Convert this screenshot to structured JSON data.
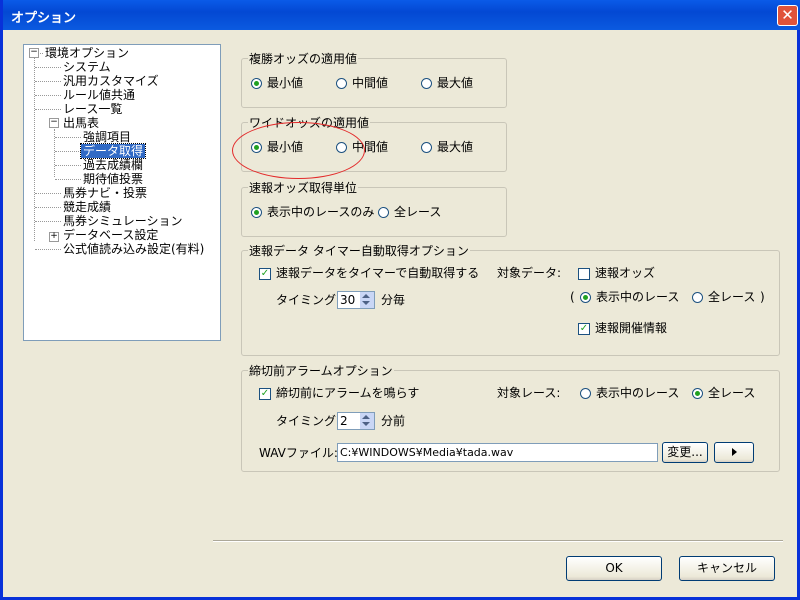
{
  "window": {
    "title": "オプション"
  },
  "tree": {
    "items": [
      {
        "label": "環境オプション",
        "expander": "−"
      },
      {
        "label": "システム"
      },
      {
        "label": "汎用カスタマイズ"
      },
      {
        "label": "ルール値共通"
      },
      {
        "label": "レース一覧"
      },
      {
        "label": "出馬表",
        "expander": "−"
      },
      {
        "label": "強調項目"
      },
      {
        "label": "データ取得",
        "selected": true
      },
      {
        "label": "過去成績欄"
      },
      {
        "label": "期待値投票"
      },
      {
        "label": "馬券ナビ・投票"
      },
      {
        "label": "競走成績"
      },
      {
        "label": "馬券シミュレーション"
      },
      {
        "label": "データベース設定",
        "expander": "+"
      },
      {
        "label": "公式値読み込み設定(有料)"
      }
    ]
  },
  "fukusho": {
    "legend": "複勝オッズの適用値",
    "options": [
      "最小値",
      "中間値",
      "最大値"
    ],
    "selected": "最小値"
  },
  "wide": {
    "legend": "ワイドオッズの適用値",
    "options": [
      "最小値",
      "中間値",
      "最大値"
    ],
    "selected": "最小値"
  },
  "sokuho_unit": {
    "legend": "速報オッズ取得単位",
    "options": [
      "表示中のレースのみ",
      "全レース"
    ],
    "selected": "表示中のレースのみ"
  },
  "timer": {
    "legend": "速報データ タイマー自動取得オプション",
    "auto_label": "速報データをタイマーで自動取得する",
    "auto_checked": true,
    "timing_label": "タイミング:",
    "timing_value": "30",
    "timing_unit": "分毎",
    "target_label": "対象データ:",
    "odds_label": "速報オッズ",
    "odds_checked": false,
    "paren_open": "(",
    "paren_close": ")",
    "scope_options": [
      "表示中のレース",
      "全レース"
    ],
    "scope_selected": "表示中のレース",
    "kaisai_label": "速報開催情報",
    "kaisai_checked": true
  },
  "alarm": {
    "legend": "締切前アラームオプション",
    "alarm_label": "締切前にアラームを鳴らす",
    "alarm_checked": true,
    "timing_label": "タイミング:",
    "timing_value": "2",
    "timing_unit": "分前",
    "target_label": "対象レース:",
    "options": [
      "表示中のレース",
      "全レース"
    ],
    "selected": "全レース",
    "wav_label": "WAVファイル:",
    "wav_path": "C:¥WINDOWS¥Media¥tada.wav",
    "change_label": "変更..."
  },
  "buttons": {
    "ok": "OK",
    "cancel": "キャンセル"
  },
  "colors": {
    "annotation_circle": "#e32b2b",
    "selection": "#316ac5",
    "titlebar": "#0348d3"
  }
}
